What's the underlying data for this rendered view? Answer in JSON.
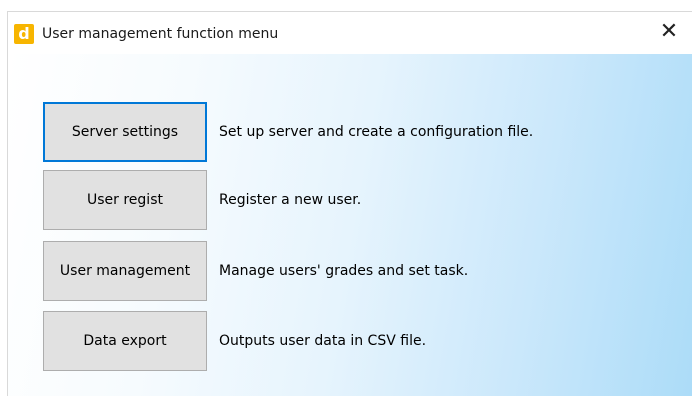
{
  "window": {
    "title": "User management function menu",
    "icon": "app-icon",
    "icon_glyph": "d",
    "close_glyph": "✕"
  },
  "menu": [
    {
      "label": "Server settings",
      "description": "Set up server and create a configuration file.",
      "focused": true
    },
    {
      "label": "User regist",
      "description": "Register a new user.",
      "focused": false
    },
    {
      "label": "User management",
      "description": "Manage users' grades and set task.",
      "focused": false
    },
    {
      "label": "Data export",
      "description": "Outputs user data in CSV file.",
      "focused": false
    }
  ],
  "colors": {
    "focus_border": "#0078d7",
    "button_face": "#e1e1e1",
    "app_icon": "#f7b500"
  }
}
